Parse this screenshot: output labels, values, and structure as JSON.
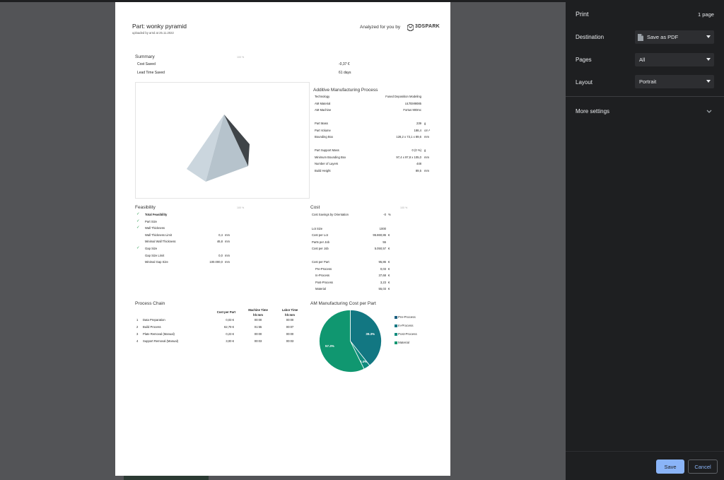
{
  "report": {
    "title": "Part: wonky pyramid",
    "uploaded": "uploaded by arnd at 25.11.2022",
    "analyzed_by": "Analyzed for you by",
    "brand": "3DSPARK",
    "summary": {
      "heading": "Summary",
      "pct": "100 %",
      "rows": [
        {
          "label": "Cost Saved",
          "value": "-0,37 €"
        },
        {
          "label": "Lead Time Saved",
          "value": "61 days"
        }
      ]
    },
    "am_process": {
      "heading": "Additive Manufacturing Process",
      "rows1": [
        {
          "label": "Technology",
          "value": "Fused Deposition Modeling",
          "unit": ""
        },
        {
          "label": "AM Material",
          "value": "ULTEM9085",
          "unit": ""
        },
        {
          "label": "AM Machine",
          "value": "Fortus 900mc",
          "unit": ""
        }
      ],
      "rows2": [
        {
          "label": "Part Mass",
          "value": "239",
          "unit": "g"
        },
        {
          "label": "Part Volume",
          "value": "188,4",
          "unit": "cm ³"
        },
        {
          "label": "Bounding Box",
          "value": "128,2 x 73,1 x 89,6",
          "unit": "mm"
        }
      ],
      "rows3": [
        {
          "label": "Part Support Mass",
          "value": "0 (0 %)",
          "unit": "g"
        },
        {
          "label": "Minimum Bounding Box",
          "value": "97,4 x 97,8 x 105,0",
          "unit": "mm"
        },
        {
          "label": "Number of Layers",
          "value": "448",
          "unit": ""
        },
        {
          "label": "Build Height",
          "value": "89,5",
          "unit": "mm"
        }
      ]
    },
    "feasibility": {
      "heading": "Feasibility",
      "pct": "100 %",
      "rows": [
        {
          "label": "Total Feasibility",
          "value": "",
          "unit": "",
          "check": "✓",
          "bold": true
        },
        {
          "label": "Part Size",
          "value": "",
          "unit": "",
          "check": "✓"
        },
        {
          "label": "Wall Thickness",
          "value": "",
          "unit": "",
          "check": "✓"
        },
        {
          "label": "Wall Thickness Limit",
          "value": "0,4",
          "unit": "mm",
          "check": ""
        },
        {
          "label": "Minimal Wall Thickness",
          "value": "46,8",
          "unit": "mm",
          "check": ""
        },
        {
          "label": "Gap Size",
          "value": "",
          "unit": "",
          "check": "✓"
        },
        {
          "label": "Gap Size Limit",
          "value": "0,0",
          "unit": "mm",
          "check": ""
        },
        {
          "label": "Minimal Gap Size",
          "value": "100.000,0",
          "unit": "mm",
          "check": ""
        }
      ]
    },
    "cost": {
      "heading": "Cost",
      "pct": "100 %",
      "rows": [
        {
          "label": "Cost Savings by Orientation",
          "value": "-0",
          "unit": "%"
        },
        {
          "label": "Lot Size",
          "value": "1000",
          "unit": ""
        },
        {
          "label": "Cost per Lot",
          "value": "95.860,86",
          "unit": "€"
        },
        {
          "label": "Parts per Job",
          "value": "55",
          "unit": ""
        },
        {
          "label": "Cost per Job",
          "value": "5.050,57",
          "unit": "€"
        },
        {
          "label": "Cost per Part",
          "value": "95,86",
          "unit": "€"
        },
        {
          "label": "Pre-Process",
          "value": "0,03",
          "unit": "€"
        },
        {
          "label": "In-Process",
          "value": "37,68",
          "unit": "€"
        },
        {
          "label": "Post-Process",
          "value": "3,23",
          "unit": "€"
        },
        {
          "label": "Material",
          "value": "55,03",
          "unit": "€"
        }
      ]
    },
    "process_chain": {
      "heading": "Process Chain",
      "col_cost": "Cost per Part",
      "col_machine": "Machine Time",
      "col_machine_sub": "hh:mm",
      "col_labor": "Labor Time",
      "col_labor_sub": "hh:mm",
      "rows": [
        {
          "no": "1",
          "step": "Data Preparation",
          "cost": "0,03 €",
          "machine": "00:00",
          "labor": "00:00"
        },
        {
          "no": "2",
          "step": "Build Process",
          "cost": "62,79 €",
          "machine": "01:55",
          "labor": "00:07"
        },
        {
          "no": "3",
          "step": "Plate Removal (Manual)",
          "cost": "0,23 €",
          "machine": "00:00",
          "labor": "00:00"
        },
        {
          "no": "4",
          "step": "Support Removal (Manual)",
          "cost": "3,00 €",
          "machine": "00:03",
          "labor": "00:03"
        }
      ]
    }
  },
  "chart_data": {
    "type": "pie",
    "title": "AM Manufacturing Cost per Part",
    "series": [
      {
        "name": "Pre-Process",
        "value": 0.03,
        "label": "",
        "color": "#1b5f80"
      },
      {
        "name": "In-Process",
        "value": 39.3,
        "label": "39.3%",
        "color": "#127782"
      },
      {
        "name": "Post-Process",
        "value": 3.4,
        "label": "3.4%",
        "color": "#0f8b7d"
      },
      {
        "name": "Material",
        "value": 57.3,
        "label": "57.3%",
        "color": "#109770"
      }
    ],
    "legend": "right"
  },
  "print_panel": {
    "title": "Print",
    "pages_count": "1 page",
    "destination_label": "Destination",
    "destination_value": "Save as PDF",
    "pages_label": "Pages",
    "pages_value": "All",
    "layout_label": "Layout",
    "layout_value": "Portrait",
    "more_settings": "More settings",
    "save": "Save",
    "cancel": "Cancel"
  }
}
